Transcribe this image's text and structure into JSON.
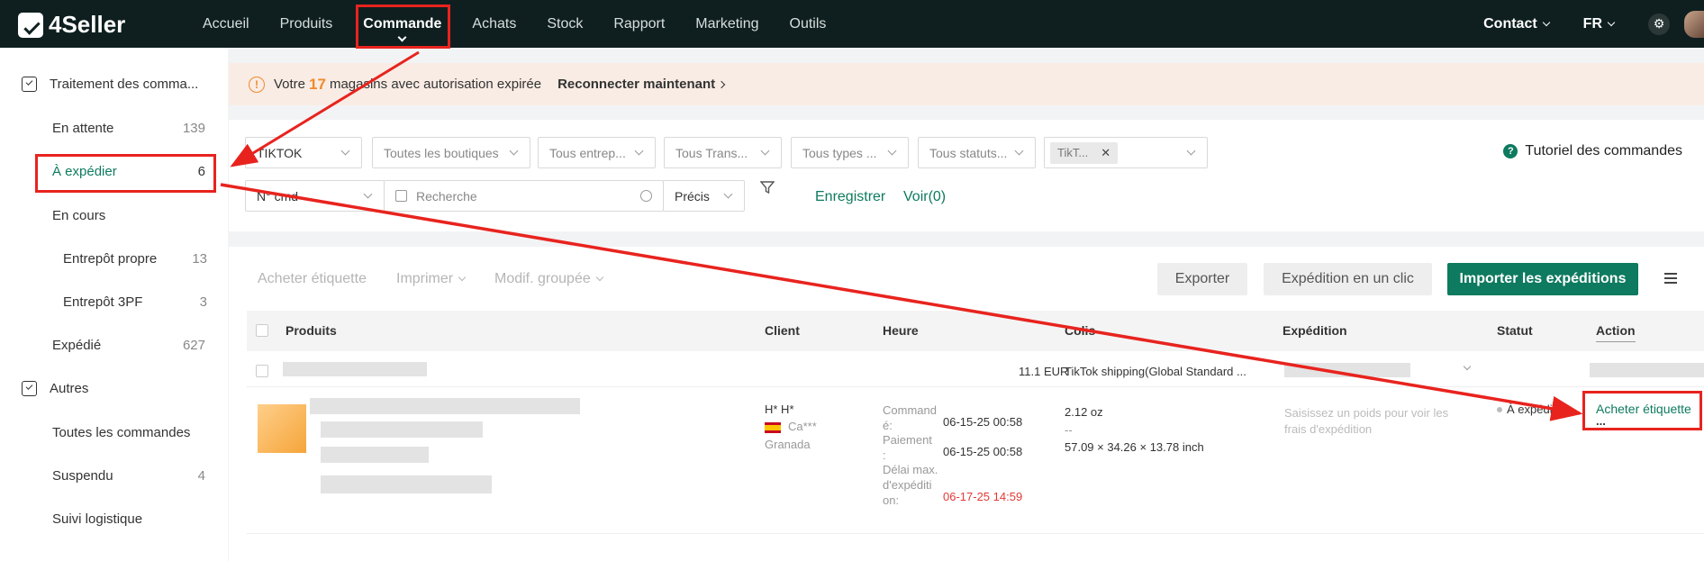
{
  "app": {
    "logo_text": "4Seller"
  },
  "nav": {
    "items": [
      "Accueil",
      "Produits",
      "Commande",
      "Achats",
      "Stock",
      "Rapport",
      "Marketing",
      "Outils"
    ],
    "active": "Commande"
  },
  "topright": {
    "contact": "Contact",
    "lang": "FR"
  },
  "sidebar": {
    "group1": "Traitement des comma...",
    "en_attente": {
      "label": "En attente",
      "count": "139"
    },
    "a_expedier": {
      "label": "À expédier",
      "count": "6"
    },
    "en_cours": {
      "label": "En cours"
    },
    "entrepot_propre": {
      "label": "Entrepôt propre",
      "count": "13"
    },
    "entrepot_3pf": {
      "label": "Entrepôt 3PF",
      "count": "3"
    },
    "expedie": {
      "label": "Expédié",
      "count": "627"
    },
    "group2": "Autres",
    "toutes": {
      "label": "Toutes les commandes"
    },
    "suspendu": {
      "label": "Suspendu",
      "count": "4"
    },
    "suivi": {
      "label": "Suivi logistique"
    }
  },
  "alert": {
    "prefix": "Votre",
    "count": "17",
    "suffix": "magasins avec autorisation expirée",
    "action": "Reconnecter maintenant"
  },
  "filters": {
    "platform": "TIKTOK",
    "shops": "Toutes les boutiques",
    "warehouses": "Tous entrep...",
    "transport": "Tous Trans...",
    "types": "Tous types ...",
    "statuses": "Tous statuts...",
    "tag": "TikT...",
    "order_no": "N° cmd",
    "search_placeholder": "Recherche",
    "precise": "Précis",
    "save": "Enregistrer",
    "view": "Voir(0)",
    "tutorial": "Tutoriel des commandes"
  },
  "toolbar": {
    "buy_label": "Acheter étiquette",
    "print": "Imprimer",
    "bulk_edit": "Modif. groupée",
    "export": "Exporter",
    "one_click": "Expédition en un clic",
    "import": "Importer les expéditions"
  },
  "table": {
    "headers": {
      "products": "Produits",
      "client": "Client",
      "time": "Heure",
      "parcel": "Colis",
      "shipping": "Expédition",
      "status": "Statut",
      "action": "Action"
    },
    "group": {
      "amount": "11.1 EUR",
      "shipping": "TikTok shipping(Global Standard ..."
    },
    "order": {
      "client_name": "H* H*",
      "client_country": "Ca***",
      "client_city": "Granada",
      "ordered_label_1": "Command",
      "ordered_label_2": "é:",
      "ordered_at": "06-15-25 00:58",
      "paid_label_1": "Paiement",
      "paid_label_2": ":",
      "paid_at": "06-15-25 00:58",
      "deadline_label_1": "Délai max.",
      "deadline_label_2": "d'expéditi",
      "deadline_label_3": "on:",
      "deadline_at": "06-17-25 14:59",
      "weight": "2.12 oz",
      "dash": "--",
      "dimensions": "57.09 × 34.26 × 13.78 inch",
      "shipping_hint_1": "Saisissez un poids pour voir les",
      "shipping_hint_2": "frais d'expédition",
      "status": "À expédier",
      "action": "Acheter étiquette",
      "more": "..."
    }
  },
  "colors": {
    "accent": "#0e7a5f",
    "topbar": "#0f1f1f",
    "warning": "#f08a2c",
    "annotation": "#e8231e"
  }
}
